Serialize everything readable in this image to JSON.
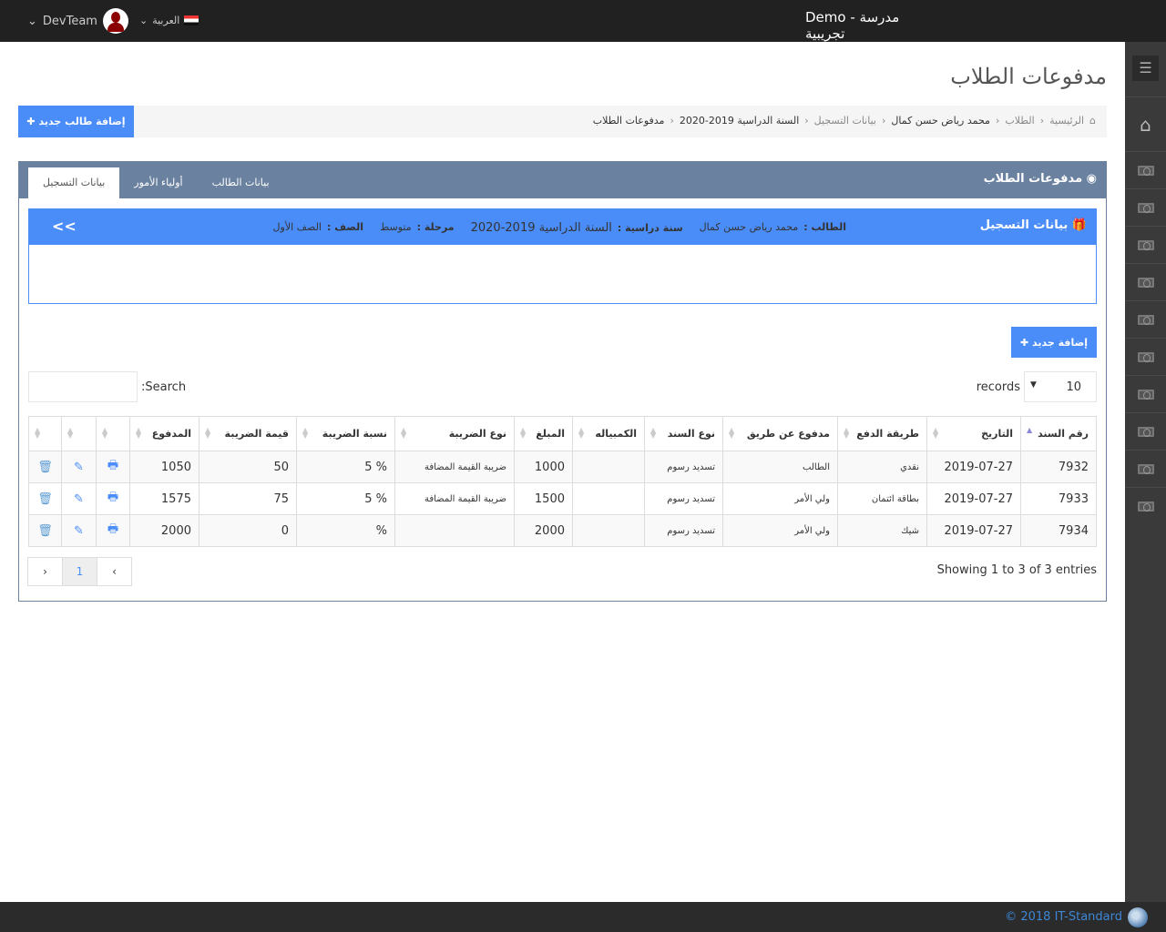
{
  "topbar": {
    "brand": "Demo - مدرسة تجريبية",
    "user": "DevTeam",
    "language": "العربية"
  },
  "page_title": "مدفوعات الطلاب",
  "breadcrumb": [
    "الرئيسية",
    "الطلاب",
    "محمد رياض حسن كمال",
    "بيانات التسجيل",
    "السنة الدراسية 2019-2020",
    "مدفوعات الطلاب"
  ],
  "add_student_label": "إضافة طالب جديد",
  "portlet": {
    "title": "مدفوعات الطلاب",
    "tabs": [
      "بيانات التسجيل",
      "أولياء الأمور",
      "بيانات الطالب"
    ]
  },
  "registration": {
    "title": "بيانات التسجيل",
    "collapse": "<<",
    "student_label": "الطالب :",
    "student": "محمد رياض حسن كمال",
    "year_label": "سنة دراسية :",
    "year": "السنة الدراسية 2019-2020",
    "stage_label": "مرحلة :",
    "stage": "متوسط",
    "grade_label": "الصف :",
    "grade": "الصف الأول"
  },
  "add_new_label": "إضافة جديد",
  "records": {
    "value": "10",
    "label": "records"
  },
  "search_label": "Search:",
  "table": {
    "headers": [
      "رقم السند",
      "التاريخ",
      "طريقة الدفع",
      "مدفوع عن طريق",
      "نوع السند",
      "الكمبياله",
      "المبلغ",
      "نوع الضريبة",
      "نسبة الضريبة",
      "قيمة الضريبة",
      "المدفوع"
    ],
    "rows": [
      [
        "7932",
        "2019-07-27",
        "نقدي",
        "الطالب",
        "تسديد رسوم",
        "",
        "1000",
        "ضريبة القيمة المضافة",
        "% 5",
        "50",
        "1050"
      ],
      [
        "7933",
        "2019-07-27",
        "بطاقة ائتمان",
        "ولي الأمر",
        "تسديد رسوم",
        "",
        "1500",
        "ضريبة القيمة المضافة",
        "% 5",
        "75",
        "1575"
      ],
      [
        "7934",
        "2019-07-27",
        "شيك",
        "ولي الأمر",
        "تسديد رسوم",
        "",
        "2000",
        "",
        "%",
        "0",
        "2000"
      ]
    ]
  },
  "showing": "Showing 1 to 3 of 3 entries",
  "pager": {
    "prev": "‹",
    "page": "1",
    "next": "›"
  },
  "footer": "© 2018 IT-Standard"
}
